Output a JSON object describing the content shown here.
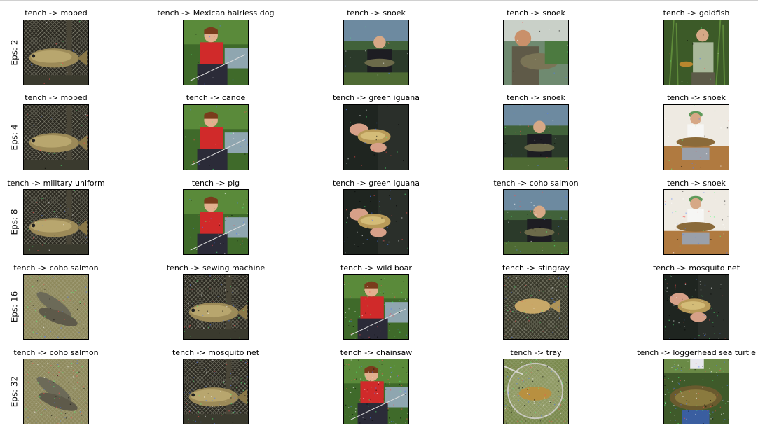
{
  "rows": [
    {
      "label": "Eps: 2",
      "cells": [
        {
          "title": "tench -> moped",
          "scene": "fish-net",
          "noise": 0.05
        },
        {
          "title": "tench -> Mexican hairless dog",
          "scene": "boy-red-shirt",
          "noise": 0.05
        },
        {
          "title": "tench -> snoek",
          "scene": "man-lake-dark",
          "noise": 0.05
        },
        {
          "title": "tench -> snoek",
          "scene": "man-holding-fish",
          "noise": 0.05
        },
        {
          "title": "tench -> goldfish",
          "scene": "man-reeds",
          "noise": 0.05
        }
      ]
    },
    {
      "label": "Eps: 4",
      "cells": [
        {
          "title": "tench -> moped",
          "scene": "fish-net",
          "noise": 0.1
        },
        {
          "title": "tench -> canoe",
          "scene": "boy-red-shirt",
          "noise": 0.1
        },
        {
          "title": "tench -> green iguana",
          "scene": "hands-fish-dark",
          "noise": 0.1
        },
        {
          "title": "tench -> snoek",
          "scene": "man-lake-dark",
          "noise": 0.1
        },
        {
          "title": "tench -> snoek",
          "scene": "man-cap-white",
          "noise": 0.1
        }
      ]
    },
    {
      "label": "Eps: 8",
      "cells": [
        {
          "title": "tench -> military uniform",
          "scene": "fish-net",
          "noise": 0.18
        },
        {
          "title": "tench -> pig",
          "scene": "boy-red-shirt",
          "noise": 0.18
        },
        {
          "title": "tench -> green iguana",
          "scene": "hands-fish-dark",
          "noise": 0.18
        },
        {
          "title": "tench -> coho salmon",
          "scene": "man-lake-dark",
          "noise": 0.18
        },
        {
          "title": "tench -> snoek",
          "scene": "man-cap-white",
          "noise": 0.18
        }
      ]
    },
    {
      "label": "Eps: 16",
      "cells": [
        {
          "title": "tench -> coho salmon",
          "scene": "two-fish-grass",
          "noise": 0.3
        },
        {
          "title": "tench -> sewing machine",
          "scene": "fish-net",
          "noise": 0.3
        },
        {
          "title": "tench -> wild boar",
          "scene": "boy-red-shirt",
          "noise": 0.3
        },
        {
          "title": "tench -> stingray",
          "scene": "fish-dark-net",
          "noise": 0.3
        },
        {
          "title": "tench -> mosquito net",
          "scene": "hands-fish-dark",
          "noise": 0.3
        }
      ]
    },
    {
      "label": "Eps: 32",
      "cells": [
        {
          "title": "tench -> coho salmon",
          "scene": "two-fish-grass",
          "noise": 0.45
        },
        {
          "title": "tench -> mosquito net",
          "scene": "fish-net",
          "noise": 0.45
        },
        {
          "title": "tench -> chainsaw",
          "scene": "boy-red-shirt",
          "noise": 0.45
        },
        {
          "title": "tench -> tray",
          "scene": "fish-landing-net",
          "noise": 0.45
        },
        {
          "title": "tench -> loggerhead sea turtle",
          "scene": "man-big-fish",
          "noise": 0.45
        }
      ]
    }
  ],
  "colors": {
    "text": "#000000",
    "border": "#000000",
    "rule": "#d0d0d0"
  }
}
